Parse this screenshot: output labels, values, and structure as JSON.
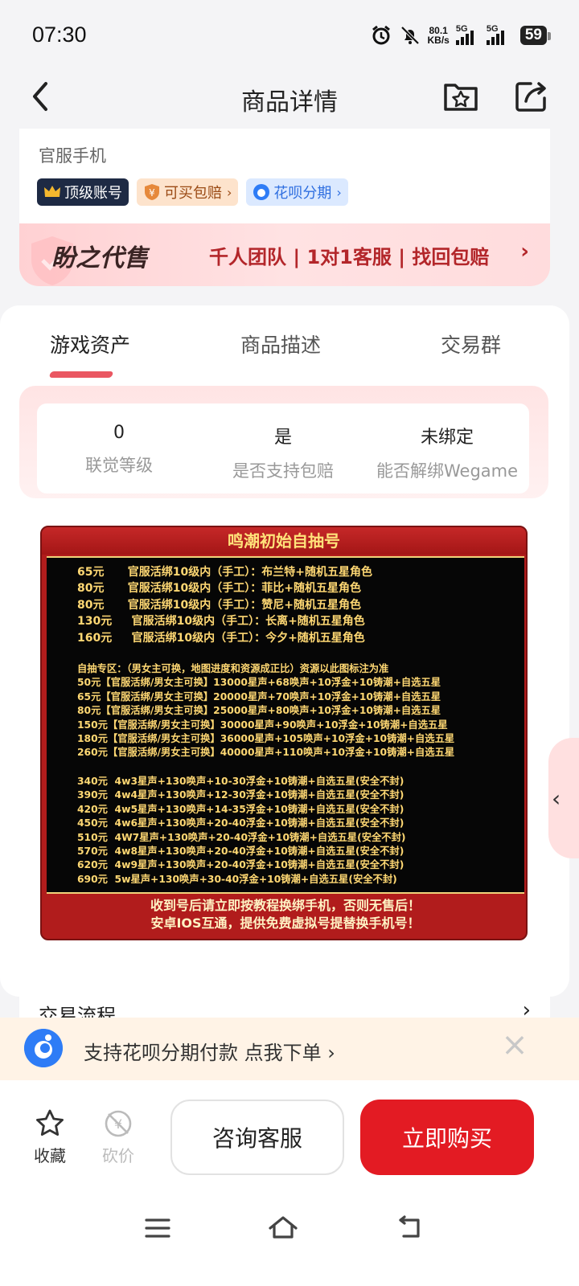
{
  "status": {
    "time": "07:30",
    "net_speed_top": "80.1",
    "net_speed_bottom": "KB/s",
    "sim1": "5G",
    "sim2": "5G",
    "battery": "59"
  },
  "header": {
    "title": "商品详情",
    "back_icon": "chevron-left-icon",
    "favorite_icon": "star-folder-icon",
    "share_icon": "share-icon"
  },
  "product": {
    "category": "官服手机",
    "tags": [
      {
        "label": "顶级账号",
        "icon": "crown-icon"
      },
      {
        "label": "可买包赔",
        "icon": "shield-yen-icon",
        "chevron": "›"
      },
      {
        "label": "花呗分期",
        "icon": "huabei-icon",
        "chevron": "›"
      }
    ],
    "banner": {
      "brand": "盼之代售",
      "slogan": "千人团队 | 1对1客服 | 找回包赔",
      "chevron": "›"
    }
  },
  "tabs": [
    {
      "label": "游戏资产",
      "active": true
    },
    {
      "label": "商品描述",
      "active": false
    },
    {
      "label": "交易群",
      "active": false
    }
  ],
  "assets": [
    {
      "value": "0",
      "label": "联觉等级"
    },
    {
      "value": "是",
      "label": "是否支持包赔"
    },
    {
      "value": "未绑定",
      "label": "能否解绑Wegame"
    }
  ],
  "image": {
    "title": "鸣潮初始自抽号",
    "lines_a": [
      "65元      官服活绑10级内（手工）：布兰特+随机五星角色",
      "80元      官服活绑10级内（手工）：菲比+随机五星角色",
      "80元      官服活绑10级内（手工）：赞尼+随机五星角色",
      "130元     官服活绑10级内（手工）：长离+随机五星角色",
      "160元     官服活绑10级内（手工）：今夕+随机五星角色"
    ],
    "lines_b": [
      "自抽专区：（男女主可换，地图进度和资源成正比）资源以此图标注为准",
      "50元【官服活绑/男女主可换】13000星声+68唤声+10浮金+10铸潮+自选五星",
      "65元【官服活绑/男女主可换】20000星声+70唤声+10浮金+10铸潮+自选五星",
      "80元【官服活绑/男女主可换】25000星声+80唤声+10浮金+10铸潮+自选五星",
      "150元【官服活绑/男女主可换】30000星声+90唤声+10浮金+10铸潮+自选五星",
      "180元【官服活绑/男女主可换】36000星声+105唤声+10浮金+10铸潮+自选五星",
      "260元【官服活绑/男女主可换】40000星声+110唤声+10浮金+10铸潮+自选五星"
    ],
    "lines_c": [
      "340元  4w3星声+130唤声+10-30浮金+10铸潮+自选五星(安全不封)",
      "390元  4w4星声+130唤声+12-30浮金+10铸潮+自选五星(安全不封)",
      "420元  4w5星声+130唤声+14-35浮金+10铸潮+自选五星(安全不封)",
      "450元  4w6星声+130唤声+20-40浮金+10铸潮+自选五星(安全不封)",
      "510元  4W7星声+130唤声+20-40浮金+10铸潮+自选五星(安全不封)",
      "570元  4w8星声+130唤声+20-40浮金+10铸潮+自选五星(安全不封)",
      "620元  4w9星声+130唤声+20-40浮金+10铸潮+自选五星(安全不封)",
      "690元  5w星声+130唤声+30-40浮金+10铸潮+自选五星(安全不封)"
    ],
    "footer_1": "收到号后请立即按教程换绑手机，否则无售后！",
    "footer_2": "安卓IOS互通，提供免费虚拟号提替换手机号！"
  },
  "flow": {
    "title": "交易流程",
    "chevron": "›"
  },
  "side_tab": {
    "chevron": "‹"
  },
  "promo": {
    "text": "支持花呗分期付款 点我下单 ›",
    "close": "×"
  },
  "bottom": {
    "favorite_label": "收藏",
    "bargain_label": "砍价",
    "consult_label": "咨询客服",
    "buy_label": "立即购买"
  },
  "colors": {
    "accent": "#e31b23",
    "banner_text": "#b3262a",
    "huabei_blue": "#2e7cf6"
  }
}
